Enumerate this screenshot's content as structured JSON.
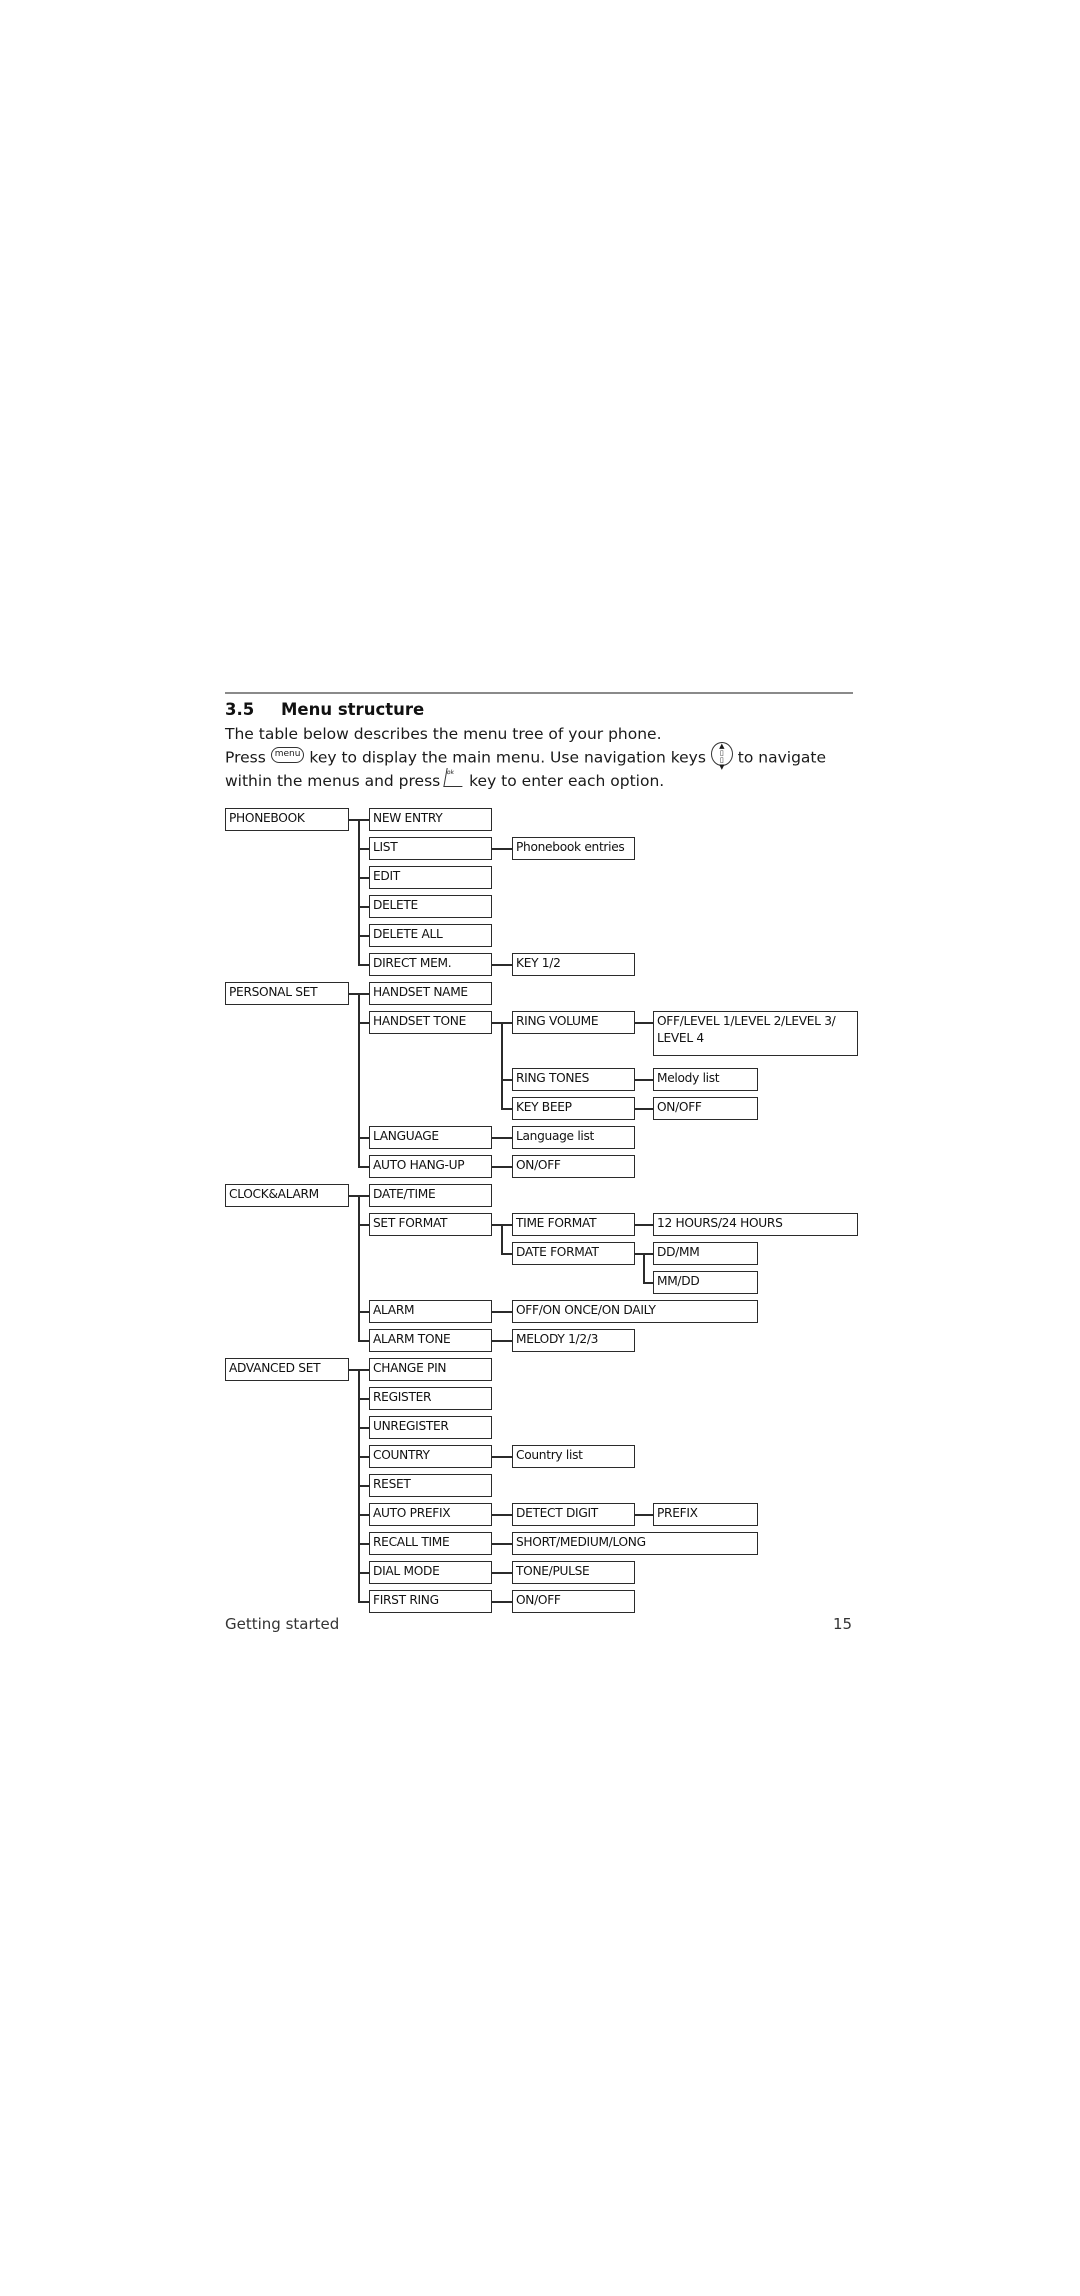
{
  "section": {
    "number": "3.5",
    "title": "Menu structure"
  },
  "intro": {
    "line1": "The table below describes the menu tree of your phone.",
    "press": "Press",
    "menu_key_label": "menu",
    "after_menu": "key to display the main menu. Use navigation keys",
    "nav_key_icon": "navigation-keys-icon",
    "after_nav": "to navigate within the menus and press",
    "ok_key_label": "ok",
    "after_ok": "key to enter each option."
  },
  "menu_tree": [
    {
      "label": "PHONEBOOK",
      "children": [
        {
          "label": "NEW ENTRY"
        },
        {
          "label": "LIST",
          "children": [
            {
              "label": "Phonebook entries"
            }
          ]
        },
        {
          "label": "EDIT"
        },
        {
          "label": "DELETE"
        },
        {
          "label": "DELETE ALL"
        },
        {
          "label": "DIRECT MEM.",
          "children": [
            {
              "label": "KEY 1/2"
            }
          ]
        }
      ]
    },
    {
      "label": "PERSONAL SET",
      "children": [
        {
          "label": "HANDSET NAME"
        },
        {
          "label": "HANDSET TONE",
          "children": [
            {
              "label": "RING VOLUME",
              "children": [
                {
                  "label": "OFF/LEVEL 1/LEVEL 2/LEVEL 3/ LEVEL 4",
                  "wide": true,
                  "tall": true
                }
              ]
            },
            {
              "label": "RING TONES",
              "children": [
                {
                  "label": "Melody list"
                }
              ]
            },
            {
              "label": "KEY BEEP",
              "children": [
                {
                  "label": "ON/OFF"
                }
              ]
            }
          ]
        },
        {
          "label": "LANGUAGE",
          "children": [
            {
              "label": "Language list"
            }
          ]
        },
        {
          "label": "AUTO HANG-UP",
          "children": [
            {
              "label": "ON/OFF"
            }
          ]
        }
      ]
    },
    {
      "label": "CLOCK&ALARM",
      "children": [
        {
          "label": "DATE/TIME"
        },
        {
          "label": "SET FORMAT",
          "children": [
            {
              "label": "TIME FORMAT",
              "children": [
                {
                  "label": "12 HOURS/24 HOURS",
                  "wide": true
                }
              ]
            },
            {
              "label": "DATE FORMAT",
              "children": [
                {
                  "label": "DD/MM"
                },
                {
                  "label": "MM/DD"
                }
              ]
            }
          ]
        },
        {
          "label": "ALARM",
          "children": [
            {
              "label": "OFF/ON ONCE/ON DAILY",
              "span": true
            }
          ]
        },
        {
          "label": "ALARM TONE",
          "children": [
            {
              "label": "MELODY 1/2/3"
            }
          ]
        }
      ]
    },
    {
      "label": "ADVANCED SET",
      "children": [
        {
          "label": "CHANGE PIN"
        },
        {
          "label": "REGISTER"
        },
        {
          "label": "UNREGISTER"
        },
        {
          "label": "COUNTRY",
          "children": [
            {
              "label": "Country list"
            }
          ]
        },
        {
          "label": "RESET"
        },
        {
          "label": "AUTO PREFIX",
          "children": [
            {
              "label": "DETECT DIGIT",
              "children": [
                {
                  "label": "PREFIX"
                }
              ]
            }
          ]
        },
        {
          "label": "RECALL TIME",
          "children": [
            {
              "label": "SHORT/MEDIUM/LONG",
              "span": true
            }
          ]
        },
        {
          "label": "DIAL MODE",
          "children": [
            {
              "label": "TONE/PULSE"
            }
          ]
        },
        {
          "label": "FIRST RING",
          "children": [
            {
              "label": "ON/OFF"
            }
          ]
        }
      ]
    }
  ],
  "footer": {
    "section_name": "Getting started",
    "page_number": "15"
  }
}
